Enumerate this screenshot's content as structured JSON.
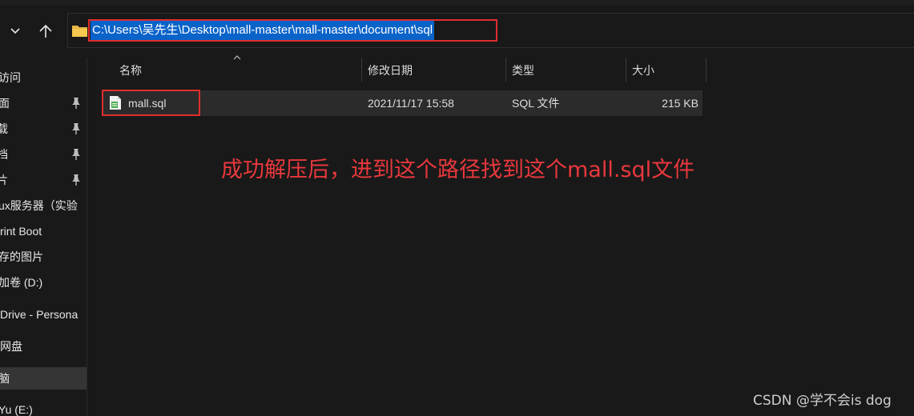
{
  "address": {
    "path": "C:\\Users\\吴先生\\Desktop\\mall-master\\mall-master\\document\\sql"
  },
  "sidebar": {
    "items": [
      {
        "label": "问访问",
        "pinned": false
      },
      {
        "label": "面",
        "pinned": true
      },
      {
        "label": "载",
        "pinned": true
      },
      {
        "label": "档",
        "pinned": true
      },
      {
        "label": "片",
        "pinned": true
      },
      {
        "label": "ux服务器（实验",
        "pinned": false
      },
      {
        "label": "rint Boot",
        "pinned": false
      },
      {
        "label": "存的图片",
        "pinned": false
      },
      {
        "label": "加卷 (D:)",
        "pinned": false
      },
      {
        "label": "Drive - Persona",
        "pinned": false
      },
      {
        "label": "网盘",
        "pinned": false
      },
      {
        "label": "脑",
        "pinned": false,
        "selected": true
      },
      {
        "label": "Yu (E:)",
        "pinned": false
      }
    ]
  },
  "columns": {
    "name": "名称",
    "modified": "修改日期",
    "type": "类型",
    "size": "大小"
  },
  "files": [
    {
      "name": "mall.sql",
      "modified": "2021/11/17 15:58",
      "type": "SQL 文件",
      "size": "215 KB"
    }
  ],
  "annotation": "成功解压后，进到这个路径找到这个mall.sql文件",
  "watermark": "CSDN @学不会is dog",
  "colors": {
    "background": "#191919",
    "selection": "#0a63c9",
    "highlight_box": "#e02d2d",
    "annotation": "#e8383d"
  }
}
